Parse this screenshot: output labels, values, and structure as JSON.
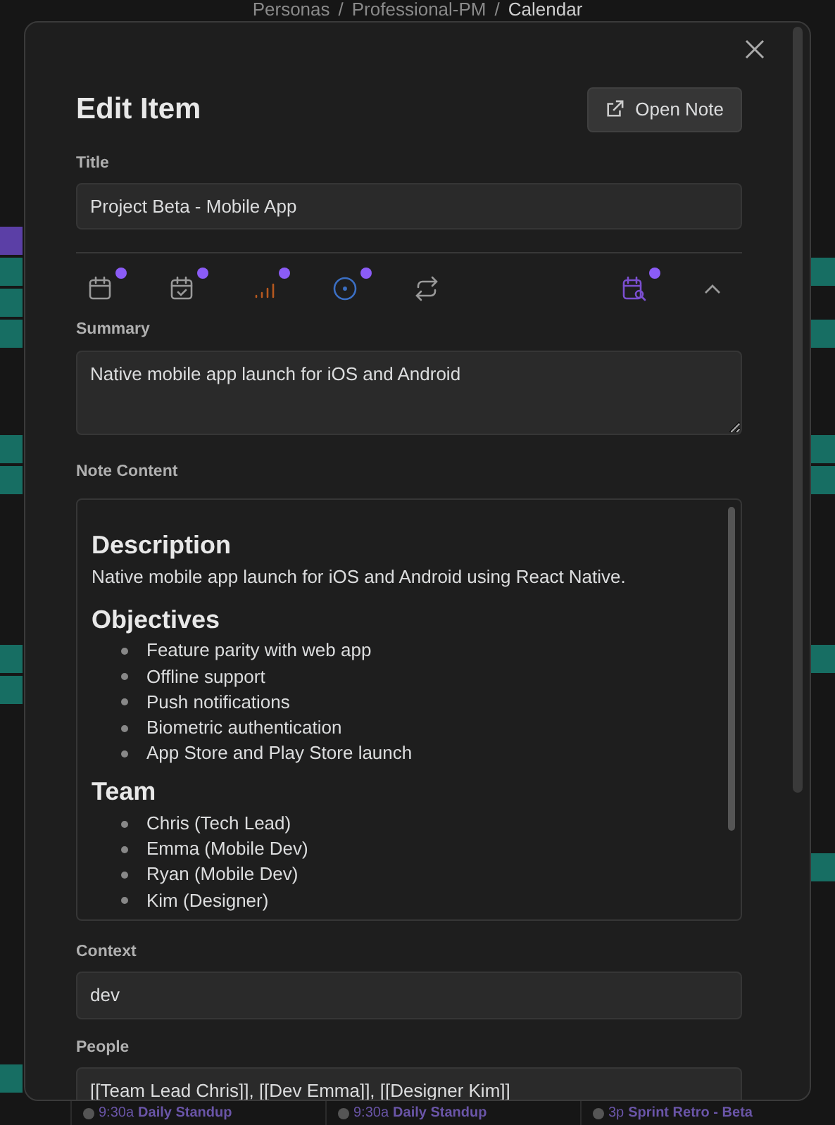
{
  "breadcrumb": [
    {
      "kind": "item",
      "text": "Personas"
    },
    {
      "kind": "separator",
      "text": "/"
    },
    {
      "kind": "item",
      "text": "Professional-PM"
    },
    {
      "kind": "separator",
      "text": "/"
    },
    {
      "kind": "current",
      "text": "Calendar"
    }
  ],
  "modal": {
    "title": "Edit Item",
    "open_button": "Open Note",
    "fields_top": {
      "label": "Title",
      "value": "Project Beta - Mobile App"
    },
    "toolbar": [
      {
        "kind": "calendar",
        "dot": true,
        "color": "#9a9a9a"
      },
      {
        "kind": "calendar-check",
        "dot": true,
        "color": "#9a9a9a"
      },
      {
        "kind": "bars",
        "dot": true,
        "color": "#b5581f"
      },
      {
        "kind": "target",
        "dot": true,
        "color": "#3b6fc4"
      },
      {
        "kind": "repeat",
        "dot": false,
        "color": "#9a9a9a"
      }
    ],
    "toolbar_right": {
      "kind": "calendar-search",
      "dot": true,
      "color": "#7b4fd0"
    },
    "summary": {
      "label": "Summary",
      "value": "Native mobile app launch for iOS and Android"
    },
    "note": {
      "label": "Note Content",
      "blocks": [
        {
          "kind": "heading",
          "text": "Description"
        },
        {
          "kind": "paragraph",
          "text": "Native mobile app launch for iOS and Android using React Native."
        },
        {
          "kind": "heading",
          "text": "Objectives"
        },
        {
          "kind": "list",
          "items": [
            "Feature parity with web app",
            "Offline support",
            "Push notifications",
            "Biometric authentication",
            "App Store and Play Store launch"
          ]
        },
        {
          "kind": "heading",
          "text": "Team"
        },
        {
          "kind": "list",
          "items": [
            "Chris (Tech Lead)",
            "Emma (Mobile Dev)",
            "Ryan (Mobile Dev)",
            "Kim (Designer)"
          ]
        }
      ]
    },
    "context": {
      "label": "Context",
      "value": "dev"
    },
    "people": {
      "label": "People",
      "value": "[[Team Lead Chris]], [[Dev Emma]], [[Designer Kim]]"
    }
  },
  "bottom_events": [
    {
      "time": "9:30a",
      "title": "Daily Standup"
    },
    {
      "time": "9:30a",
      "title": "Daily Standup"
    },
    {
      "time": "3p",
      "title": "Sprint Retro - Beta"
    }
  ]
}
